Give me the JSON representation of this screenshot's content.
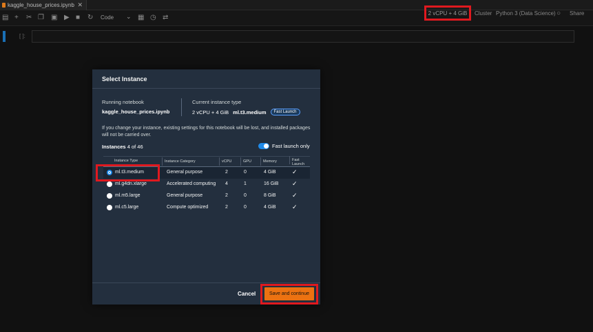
{
  "tab": {
    "title": "kaggle_house_prices.ipynb",
    "close": "✕"
  },
  "toolbar": {
    "cell_type": "Code",
    "instance": "2 vCPU + 4 GiB",
    "cluster": "Cluster",
    "kernel": "Python 3 (Data Science)",
    "share": "Share"
  },
  "cell": {
    "prompt": "[ ]:"
  },
  "modal": {
    "title": "Select Instance",
    "running_label": "Running notebook",
    "running_value": "kaggle_house_prices.ipynb",
    "current_label": "Current instance type",
    "current_spec": "2 vCPU + 4 GiB",
    "current_type": "ml.t3.medium",
    "fast_launch_badge": "Fast Launch",
    "warning": "If you change your instance, existing settings for this notebook will be lost, and installed packages will not be carried over.",
    "instances_label": "Instances",
    "instances_count": "4 of 46",
    "toggle_label": "Fast launch only",
    "columns": [
      "Instance Type",
      "Instance Category",
      "vCPU",
      "GPU",
      "Memory",
      "Fast Launch"
    ],
    "rows": [
      {
        "type": "ml.t3.medium",
        "category": "General purpose",
        "vcpu": "2",
        "gpu": "0",
        "memory": "4 GiB",
        "fast": "✓",
        "selected": true
      },
      {
        "type": "ml.g4dn.xlarge",
        "category": "Accelerated computing",
        "vcpu": "4",
        "gpu": "1",
        "memory": "16 GiB",
        "fast": "✓",
        "selected": false
      },
      {
        "type": "ml.m5.large",
        "category": "General purpose",
        "vcpu": "2",
        "gpu": "0",
        "memory": "8 GiB",
        "fast": "✓",
        "selected": false
      },
      {
        "type": "ml.c5.large",
        "category": "Compute optimized",
        "vcpu": "2",
        "gpu": "0",
        "memory": "4 GiB",
        "fast": "✓",
        "selected": false
      }
    ],
    "cancel": "Cancel",
    "save": "Save and continue"
  },
  "colors": {
    "accent": "#ec7211",
    "highlight": "#e0191f",
    "toggle": "#1f8ae8",
    "modal_bg": "#232f3e"
  },
  "icons": [
    "save-icon",
    "add-icon",
    "cut-icon",
    "copy-icon",
    "paste-icon",
    "run-icon",
    "stop-icon",
    "restart-icon",
    "chevron-down-icon",
    "terminal-icon",
    "clock-icon",
    "git-icon",
    "kernel-status-icon"
  ]
}
